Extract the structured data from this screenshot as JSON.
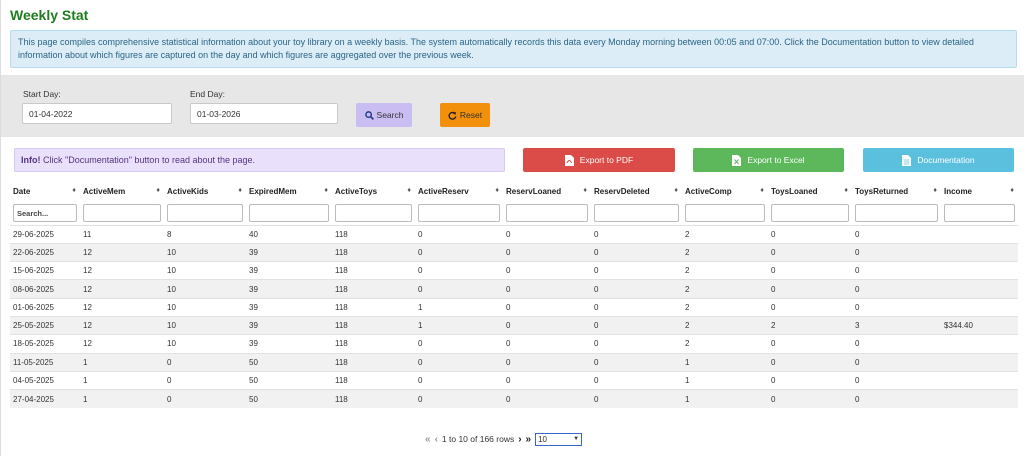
{
  "page": {
    "title": "Weekly Stat",
    "intro": "This page compiles comprehensive statistical information about your toy library on a weekly basis. The system automatically records this data every Monday morning between 00:05 and 07:00. Click the Documentation button to view detailed information about which figures are captured on the day and which figures are aggregated over the previous week."
  },
  "filters": {
    "start_label": "Start Day:",
    "start_value": "01-04-2022",
    "end_label": "End Day:",
    "end_value": "01-03-2026",
    "search_label": "Search",
    "reset_label": "Reset"
  },
  "info": {
    "prefix": "Info!",
    "text": " Click \"Documentation\" button to read about the page."
  },
  "actions": {
    "pdf": "Export to PDF",
    "excel": "Export to Excel",
    "doc": "Documentation"
  },
  "table": {
    "columns": [
      "Date",
      "ActiveMem",
      "ActiveKids",
      "ExpiredMem",
      "ActiveToys",
      "ActiveReserv",
      "ReservLoaned",
      "ReservDeleted",
      "ActiveComp",
      "ToysLoaned",
      "ToysReturned",
      "Income"
    ],
    "search_placeholder": "Search...",
    "rows": [
      [
        "29-06-2025",
        "11",
        "8",
        "40",
        "118",
        "0",
        "0",
        "0",
        "2",
        "0",
        "0",
        ""
      ],
      [
        "22-06-2025",
        "12",
        "10",
        "39",
        "118",
        "0",
        "0",
        "0",
        "2",
        "0",
        "0",
        ""
      ],
      [
        "15-06-2025",
        "12",
        "10",
        "39",
        "118",
        "0",
        "0",
        "0",
        "2",
        "0",
        "0",
        ""
      ],
      [
        "08-06-2025",
        "12",
        "10",
        "39",
        "118",
        "0",
        "0",
        "0",
        "2",
        "0",
        "0",
        ""
      ],
      [
        "01-06-2025",
        "12",
        "10",
        "39",
        "118",
        "1",
        "0",
        "0",
        "2",
        "0",
        "0",
        ""
      ],
      [
        "25-05-2025",
        "12",
        "10",
        "39",
        "118",
        "1",
        "0",
        "0",
        "2",
        "2",
        "3",
        "$344.40"
      ],
      [
        "18-05-2025",
        "12",
        "10",
        "39",
        "118",
        "0",
        "0",
        "0",
        "2",
        "0",
        "0",
        ""
      ],
      [
        "11-05-2025",
        "1",
        "0",
        "50",
        "118",
        "0",
        "0",
        "0",
        "1",
        "0",
        "0",
        ""
      ],
      [
        "04-05-2025",
        "1",
        "0",
        "50",
        "118",
        "0",
        "0",
        "0",
        "1",
        "0",
        "0",
        ""
      ],
      [
        "27-04-2025",
        "1",
        "0",
        "50",
        "118",
        "0",
        "0",
        "0",
        "1",
        "0",
        "0",
        ""
      ]
    ]
  },
  "pagination": {
    "summary": "1 to 10 of 166 rows",
    "page_size": "10"
  },
  "colors": {
    "title": "#1e7d1e",
    "search_button": "#c9bdf2",
    "reset_button": "#f2900c",
    "pdf_button": "#db4b47",
    "excel_button": "#5cb85a",
    "doc_button": "#5bc0de"
  }
}
